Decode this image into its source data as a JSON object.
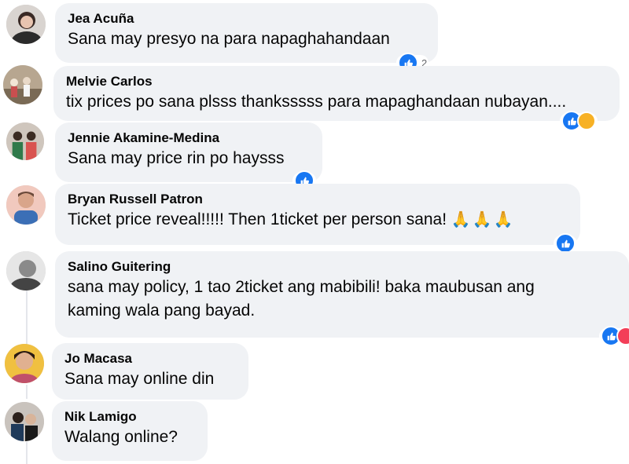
{
  "comments": [
    {
      "author": "Jea Acuña",
      "text": "Sana may presyo na para napaghahandaan",
      "reaction_count": "2"
    },
    {
      "author": "Melvie Carlos",
      "text": "tix prices po sana plsss thanksssss para mapaghandaan nubayan...."
    },
    {
      "author": "Jennie Akamine-Medina",
      "text": "Sana may price rin po haysss"
    },
    {
      "author": "Bryan Russell Patron",
      "text": "Ticket price reveal!!!!! Then 1ticket per person sana! ",
      "emoji": "🙏🙏🙏"
    },
    {
      "author": "Salino Guitering",
      "text": "sana may policy, 1 tao 2ticket ang mabibili! baka maubusan ang\nkaming wala pang bayad."
    },
    {
      "author": "Jo Macasa",
      "text": "Sana may online din"
    },
    {
      "author": "Nik Lamigo",
      "text": "Walang online?"
    }
  ],
  "icons": {
    "like": "like-icon",
    "love": "love-icon",
    "haha": "haha-icon",
    "pray": "folded-hands-emoji"
  },
  "colors": {
    "bubble": "#f0f2f5",
    "like": "#1877f2",
    "love": "#f33e58",
    "haha": "#f7b125",
    "text": "#050505"
  }
}
